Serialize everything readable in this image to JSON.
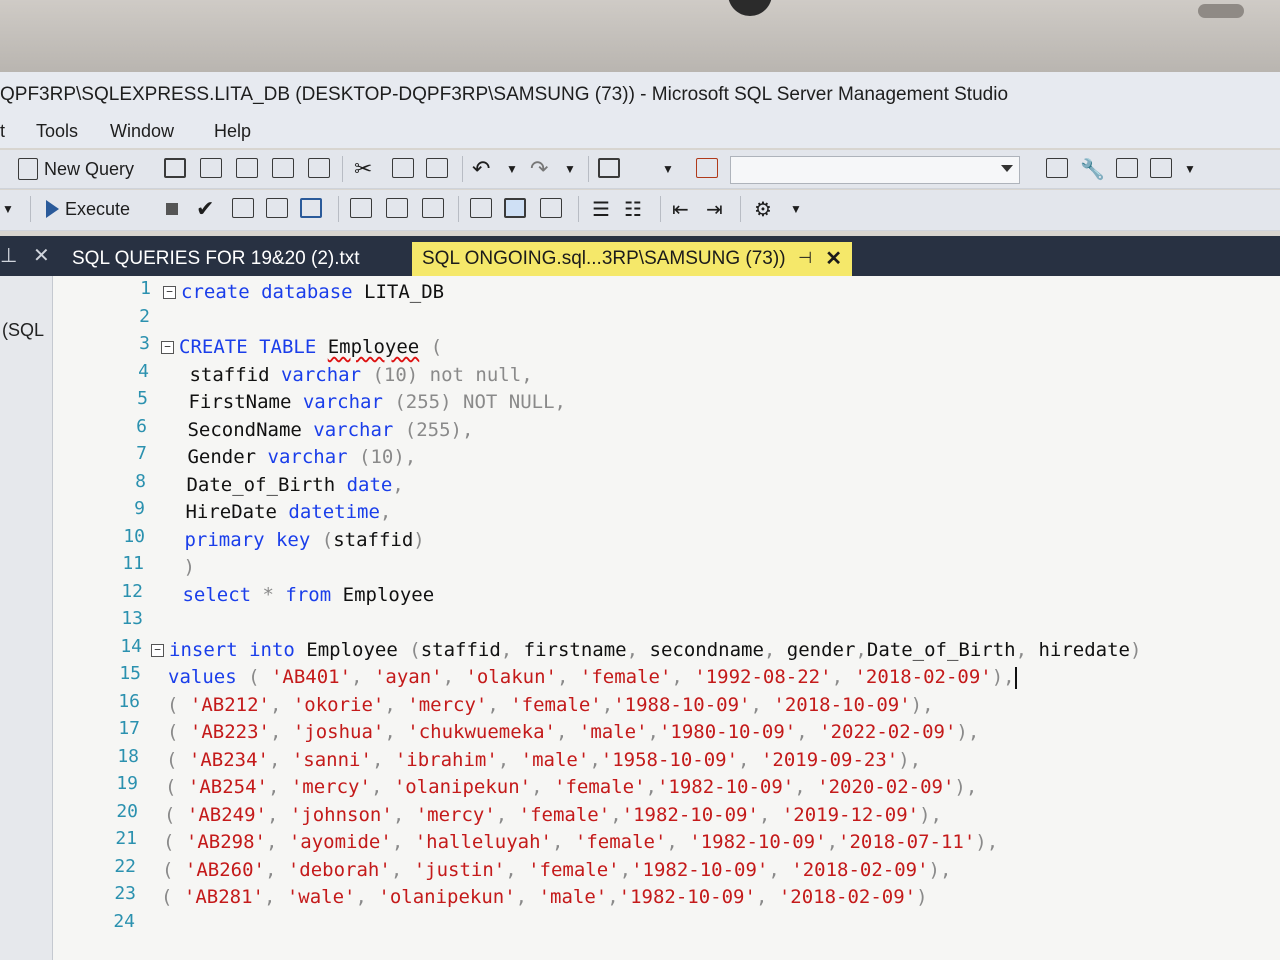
{
  "window": {
    "title": "QPF3RP\\SQLEXPRESS.LITA_DB (DESKTOP-DQPF3RP\\SAMSUNG (73)) - Microsoft SQL Server Management Studio"
  },
  "menu": {
    "items": [
      "t",
      "Tools",
      "Window",
      "Help"
    ]
  },
  "toolbar": {
    "new_query_label": "New Query",
    "execute_label": "Execute",
    "db_combo_value": ""
  },
  "tabs": [
    {
      "label": "SQL QUERIES FOR 19&20 (2).txt",
      "active": false
    },
    {
      "label": "SQL ONGOING.sql...3RP\\SAMSUNG (73))",
      "active": true
    }
  ],
  "left_panel": {
    "label": "(SQL"
  },
  "editor": {
    "line_numbers": [
      "1",
      "2",
      "3",
      "4",
      "5",
      "6",
      "7",
      "8",
      "9",
      "10",
      "11",
      "12",
      "13",
      "14",
      "15",
      "16",
      "17",
      "18",
      "19",
      "20",
      "21",
      "22",
      "23",
      "24"
    ],
    "lines": [
      [
        {
          "t": "create database",
          "c": "kw"
        },
        {
          "t": " LITA_DB",
          "c": "plain"
        }
      ],
      [],
      [
        {
          "t": "CREATE TABLE",
          "c": "kw"
        },
        {
          "t": " ",
          "c": "plain"
        },
        {
          "t": "Employee",
          "c": "plain squiggle"
        },
        {
          "t": " (",
          "c": "gray"
        }
      ],
      [
        {
          "t": " staffid ",
          "c": "plain"
        },
        {
          "t": "varchar",
          "c": "kw"
        },
        {
          "t": " (10) ",
          "c": "gray"
        },
        {
          "t": "not null",
          "c": "gray"
        },
        {
          "t": ",",
          "c": "gray"
        }
      ],
      [
        {
          "t": " FirstName ",
          "c": "plain"
        },
        {
          "t": "varchar",
          "c": "kw"
        },
        {
          "t": " (255) ",
          "c": "gray"
        },
        {
          "t": "NOT NULL",
          "c": "gray"
        },
        {
          "t": ",",
          "c": "gray"
        }
      ],
      [
        {
          "t": " SecondName ",
          "c": "plain"
        },
        {
          "t": "varchar",
          "c": "kw"
        },
        {
          "t": " (255),",
          "c": "gray"
        }
      ],
      [
        {
          "t": " Gender ",
          "c": "plain"
        },
        {
          "t": "varchar",
          "c": "kw"
        },
        {
          "t": " (10),",
          "c": "gray"
        }
      ],
      [
        {
          "t": " Date_of_Birth ",
          "c": "plain"
        },
        {
          "t": "date",
          "c": "kw"
        },
        {
          "t": ",",
          "c": "gray"
        }
      ],
      [
        {
          "t": " HireDate ",
          "c": "plain"
        },
        {
          "t": "datetime",
          "c": "kw"
        },
        {
          "t": ",",
          "c": "gray"
        }
      ],
      [
        {
          "t": " ",
          "c": "plain"
        },
        {
          "t": "primary key",
          "c": "kw"
        },
        {
          "t": " (",
          "c": "gray"
        },
        {
          "t": "staffid",
          "c": "plain"
        },
        {
          "t": ")",
          "c": "gray"
        }
      ],
      [
        {
          "t": " )",
          "c": "gray"
        }
      ],
      [
        {
          "t": " ",
          "c": "plain"
        },
        {
          "t": "select",
          "c": "kw"
        },
        {
          "t": " * ",
          "c": "gray"
        },
        {
          "t": "from",
          "c": "kw"
        },
        {
          "t": " Employee",
          "c": "plain"
        }
      ],
      [],
      [
        {
          "t": "insert into",
          "c": "kw"
        },
        {
          "t": " Employee ",
          "c": "plain"
        },
        {
          "t": "(",
          "c": "gray"
        },
        {
          "t": "staffid",
          "c": "plain"
        },
        {
          "t": ", ",
          "c": "gray"
        },
        {
          "t": "firstname",
          "c": "plain"
        },
        {
          "t": ", ",
          "c": "gray"
        },
        {
          "t": "secondname",
          "c": "plain"
        },
        {
          "t": ", ",
          "c": "gray"
        },
        {
          "t": "gender",
          "c": "plain"
        },
        {
          "t": ",",
          "c": "gray"
        },
        {
          "t": "Date_of_Birth",
          "c": "plain"
        },
        {
          "t": ", ",
          "c": "gray"
        },
        {
          "t": "hiredate",
          "c": "plain"
        },
        {
          "t": ")",
          "c": "gray"
        }
      ],
      [
        {
          "t": "values",
          "c": "kw"
        },
        {
          "t": " ( ",
          "c": "gray"
        },
        {
          "t": "'AB401'",
          "c": "str"
        },
        {
          "t": ", ",
          "c": "gray"
        },
        {
          "t": "'ayan'",
          "c": "str"
        },
        {
          "t": ", ",
          "c": "gray"
        },
        {
          "t": "'olakun'",
          "c": "str"
        },
        {
          "t": ", ",
          "c": "gray"
        },
        {
          "t": "'female'",
          "c": "str"
        },
        {
          "t": ", ",
          "c": "gray"
        },
        {
          "t": "'1992-08-22'",
          "c": "str"
        },
        {
          "t": ", ",
          "c": "gray"
        },
        {
          "t": "'2018-02-09'",
          "c": "str"
        },
        {
          "t": "),",
          "c": "gray"
        }
      ],
      [
        {
          "t": "( ",
          "c": "gray"
        },
        {
          "t": "'AB212'",
          "c": "str"
        },
        {
          "t": ", ",
          "c": "gray"
        },
        {
          "t": "'okorie'",
          "c": "str"
        },
        {
          "t": ", ",
          "c": "gray"
        },
        {
          "t": "'mercy'",
          "c": "str"
        },
        {
          "t": ", ",
          "c": "gray"
        },
        {
          "t": "'female'",
          "c": "str"
        },
        {
          "t": ",",
          "c": "gray"
        },
        {
          "t": "'1988-10-09'",
          "c": "str"
        },
        {
          "t": ", ",
          "c": "gray"
        },
        {
          "t": "'2018-10-09'",
          "c": "str"
        },
        {
          "t": "),",
          "c": "gray"
        }
      ],
      [
        {
          "t": "( ",
          "c": "gray"
        },
        {
          "t": "'AB223'",
          "c": "str"
        },
        {
          "t": ", ",
          "c": "gray"
        },
        {
          "t": "'joshua'",
          "c": "str"
        },
        {
          "t": ", ",
          "c": "gray"
        },
        {
          "t": "'chukwuemeka'",
          "c": "str"
        },
        {
          "t": ", ",
          "c": "gray"
        },
        {
          "t": "'male'",
          "c": "str"
        },
        {
          "t": ",",
          "c": "gray"
        },
        {
          "t": "'1980-10-09'",
          "c": "str"
        },
        {
          "t": ", ",
          "c": "gray"
        },
        {
          "t": "'2022-02-09'",
          "c": "str"
        },
        {
          "t": "),",
          "c": "gray"
        }
      ],
      [
        {
          "t": "( ",
          "c": "gray"
        },
        {
          "t": "'AB234'",
          "c": "str"
        },
        {
          "t": ", ",
          "c": "gray"
        },
        {
          "t": "'sanni'",
          "c": "str"
        },
        {
          "t": ", ",
          "c": "gray"
        },
        {
          "t": "'ibrahim'",
          "c": "str"
        },
        {
          "t": ", ",
          "c": "gray"
        },
        {
          "t": "'male'",
          "c": "str"
        },
        {
          "t": ",",
          "c": "gray"
        },
        {
          "t": "'1958-10-09'",
          "c": "str"
        },
        {
          "t": ", ",
          "c": "gray"
        },
        {
          "t": "'2019-09-23'",
          "c": "str"
        },
        {
          "t": "),",
          "c": "gray"
        }
      ],
      [
        {
          "t": "( ",
          "c": "gray"
        },
        {
          "t": "'AB254'",
          "c": "str"
        },
        {
          "t": ", ",
          "c": "gray"
        },
        {
          "t": "'mercy'",
          "c": "str"
        },
        {
          "t": ", ",
          "c": "gray"
        },
        {
          "t": "'olanipekun'",
          "c": "str"
        },
        {
          "t": ", ",
          "c": "gray"
        },
        {
          "t": "'female'",
          "c": "str"
        },
        {
          "t": ",",
          "c": "gray"
        },
        {
          "t": "'1982-10-09'",
          "c": "str"
        },
        {
          "t": ", ",
          "c": "gray"
        },
        {
          "t": "'2020-02-09'",
          "c": "str"
        },
        {
          "t": "),",
          "c": "gray"
        }
      ],
      [
        {
          "t": "( ",
          "c": "gray"
        },
        {
          "t": "'AB249'",
          "c": "str"
        },
        {
          "t": ", ",
          "c": "gray"
        },
        {
          "t": "'johnson'",
          "c": "str"
        },
        {
          "t": ", ",
          "c": "gray"
        },
        {
          "t": "'mercy'",
          "c": "str"
        },
        {
          "t": ", ",
          "c": "gray"
        },
        {
          "t": "'female'",
          "c": "str"
        },
        {
          "t": ",",
          "c": "gray"
        },
        {
          "t": "'1982-10-09'",
          "c": "str"
        },
        {
          "t": ", ",
          "c": "gray"
        },
        {
          "t": "'2019-12-09'",
          "c": "str"
        },
        {
          "t": "),",
          "c": "gray"
        }
      ],
      [
        {
          "t": "( ",
          "c": "gray"
        },
        {
          "t": "'AB298'",
          "c": "str"
        },
        {
          "t": ", ",
          "c": "gray"
        },
        {
          "t": "'ayomide'",
          "c": "str"
        },
        {
          "t": ", ",
          "c": "gray"
        },
        {
          "t": "'halleluyah'",
          "c": "str"
        },
        {
          "t": ", ",
          "c": "gray"
        },
        {
          "t": "'female'",
          "c": "str"
        },
        {
          "t": ", ",
          "c": "gray"
        },
        {
          "t": "'1982-10-09'",
          "c": "str"
        },
        {
          "t": ",",
          "c": "gray"
        },
        {
          "t": "'2018-07-11'",
          "c": "str"
        },
        {
          "t": "),",
          "c": "gray"
        }
      ],
      [
        {
          "t": "( ",
          "c": "gray"
        },
        {
          "t": "'AB260'",
          "c": "str"
        },
        {
          "t": ", ",
          "c": "gray"
        },
        {
          "t": "'deborah'",
          "c": "str"
        },
        {
          "t": ", ",
          "c": "gray"
        },
        {
          "t": "'justin'",
          "c": "str"
        },
        {
          "t": ", ",
          "c": "gray"
        },
        {
          "t": "'female'",
          "c": "str"
        },
        {
          "t": ",",
          "c": "gray"
        },
        {
          "t": "'1982-10-09'",
          "c": "str"
        },
        {
          "t": ", ",
          "c": "gray"
        },
        {
          "t": "'2018-02-09'",
          "c": "str"
        },
        {
          "t": "),",
          "c": "gray"
        }
      ],
      [
        {
          "t": "( ",
          "c": "gray"
        },
        {
          "t": "'AB281'",
          "c": "str"
        },
        {
          "t": ", ",
          "c": "gray"
        },
        {
          "t": "'wale'",
          "c": "str"
        },
        {
          "t": ", ",
          "c": "gray"
        },
        {
          "t": "'olanipekun'",
          "c": "str"
        },
        {
          "t": ", ",
          "c": "gray"
        },
        {
          "t": "'male'",
          "c": "str"
        },
        {
          "t": ",",
          "c": "gray"
        },
        {
          "t": "'1982-10-09'",
          "c": "str"
        },
        {
          "t": ", ",
          "c": "gray"
        },
        {
          "t": "'2018-02-09'",
          "c": "str"
        },
        {
          "t": ")",
          "c": "gray"
        }
      ],
      []
    ]
  },
  "colors": {
    "keyword": "#1a3eea",
    "string": "#c41a1a",
    "line_number": "#2b91af",
    "active_tab": "#f5e86a",
    "tab_bar": "#283142"
  }
}
